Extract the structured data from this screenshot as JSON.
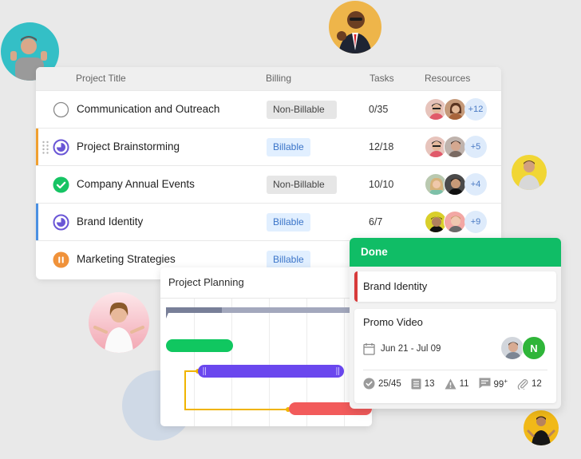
{
  "table": {
    "columns": {
      "title": "Project Title",
      "billing": "Billing",
      "tasks": "Tasks",
      "resources": "Resources"
    },
    "rows": [
      {
        "title": "Communication and Outreach",
        "status": "not-started",
        "billing": "Non-Billable",
        "billing_type": "non-billable",
        "tasks": "0/35",
        "more": "+12",
        "accent": ""
      },
      {
        "title": "Project Brainstorming",
        "status": "in-progress",
        "billing": "Billable",
        "billing_type": "billable",
        "tasks": "12/18",
        "more": "+5",
        "accent": "#f0a030"
      },
      {
        "title": "Company Annual Events",
        "status": "completed",
        "billing": "Non-Billable",
        "billing_type": "non-billable",
        "tasks": "10/10",
        "more": "+4",
        "accent": ""
      },
      {
        "title": "Brand Identity",
        "status": "in-progress",
        "billing": "Billable",
        "billing_type": "billable",
        "tasks": "6/7",
        "more": "+9",
        "accent": "#4a90e2"
      },
      {
        "title": "Marketing Strategies",
        "status": "paused",
        "billing": "Billable",
        "billing_type": "billable",
        "tasks": "",
        "more": "",
        "accent": ""
      }
    ]
  },
  "gantt": {
    "title": "Project Planning",
    "bars": [
      {
        "name": "summary",
        "color": "#8a91aa"
      },
      {
        "name": "task-green",
        "color": "#10c760"
      },
      {
        "name": "task-purple",
        "color": "#6a47ee"
      },
      {
        "name": "task-red",
        "color": "#f25b5b"
      }
    ],
    "dependency_color": "#f0b400"
  },
  "kanban": {
    "column_title": "Done",
    "column_color": "#10bd66",
    "cards": [
      {
        "title": "Brand Identity",
        "accent": "#d73a3a"
      },
      {
        "title": "Promo Video",
        "date_range": "Jun 21 - Jul 09",
        "assignee_initial": "N",
        "stats": {
          "subtasks": "25/45",
          "lists": "13",
          "issues": "11",
          "comments": "99",
          "comments_suffix": "+",
          "attachments": "12"
        }
      }
    ]
  },
  "colors": {
    "in_progress": "#6a56d6",
    "completed": "#16c464",
    "paused": "#f0923a",
    "billable_bg": "#e1efff",
    "billable_text": "#3b74c8"
  }
}
